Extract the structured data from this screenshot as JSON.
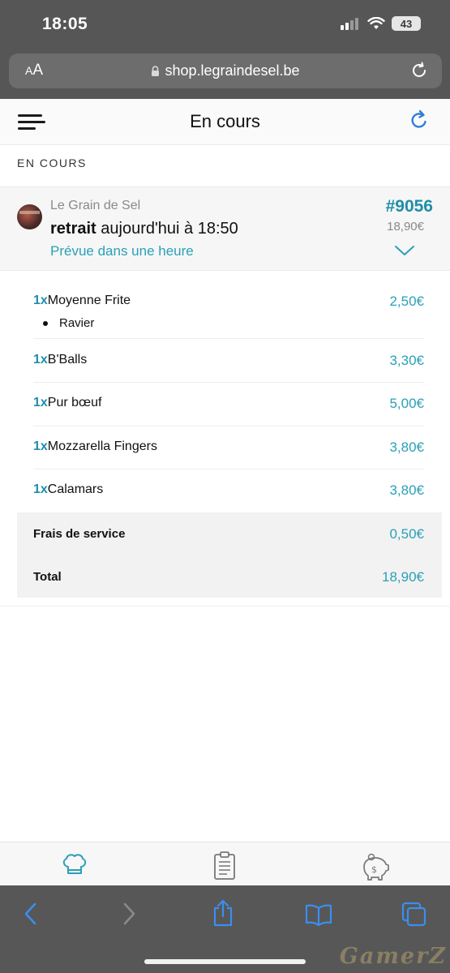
{
  "status_bar": {
    "time": "18:05",
    "battery": "43"
  },
  "browser": {
    "aa_label": "AA",
    "url": "shop.legraindesel.be"
  },
  "header": {
    "title": "En cours"
  },
  "section_label": "EN COURS",
  "order": {
    "restaurant": "Le Grain de Sel",
    "pickup_bold": "retrait",
    "pickup_time": " aujourd'hui à 18:50",
    "eta": "Prévue dans une heure",
    "number": "#9056",
    "price": "18,90€"
  },
  "items": [
    {
      "qty": "1x",
      "name": "Moyenne Frite",
      "price": "2,50€",
      "option": "Ravier"
    },
    {
      "qty": "1x",
      "name": "B'Balls",
      "price": "3,30€"
    },
    {
      "qty": "1x",
      "name": "Pur bœuf",
      "price": "5,00€"
    },
    {
      "qty": "1x",
      "name": "Mozzarella Fingers",
      "price": "3,80€"
    },
    {
      "qty": "1x",
      "name": "Calamars",
      "price": "3,80€"
    }
  ],
  "totals": {
    "service_label": "Frais de service",
    "service_value": "0,50€",
    "total_label": "Total",
    "total_value": "18,90€"
  },
  "tabs": [
    {
      "icon": "chef-hat-icon"
    },
    {
      "icon": "clipboard-icon"
    },
    {
      "icon": "piggy-bank-icon"
    }
  ],
  "watermark": "GamerZ",
  "colors": {
    "accent": "#2aa0b8",
    "accent_dark": "#1f8ea8",
    "safari_chrome": "#575757",
    "ios_blue": "#3b8ef0"
  }
}
